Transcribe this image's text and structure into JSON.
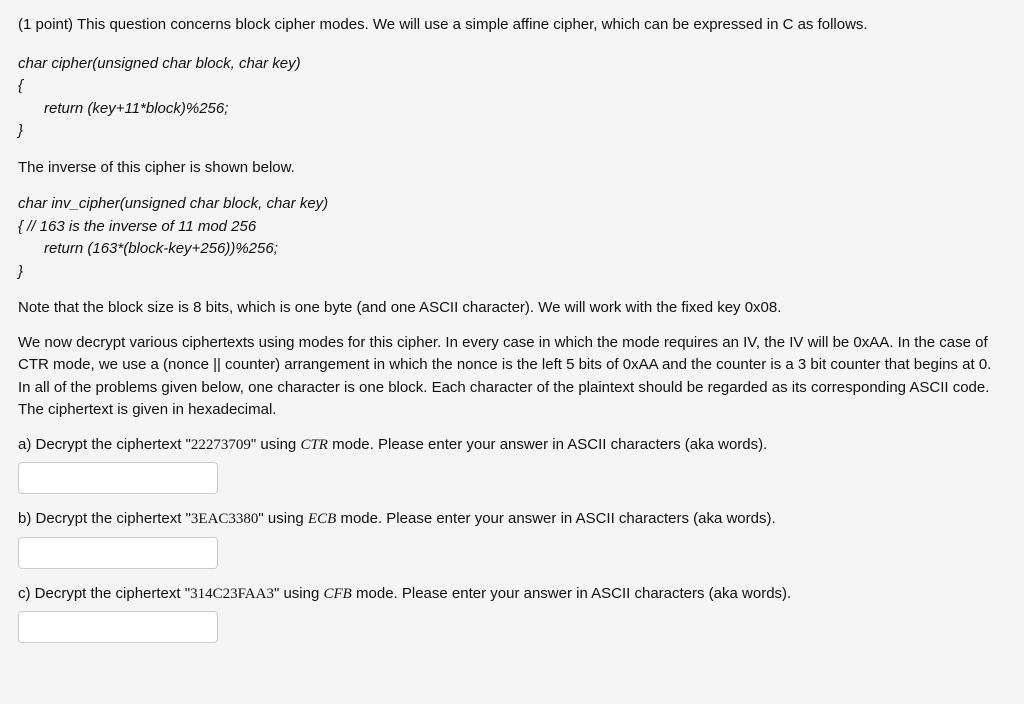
{
  "points": "(1 point)",
  "intro": "This question concerns block cipher modes. We will use a simple affine cipher, which can be expressed in C as follows.",
  "code1_l1": "char cipher(unsigned char block, char key)",
  "code1_l2": "{",
  "code1_l3": "return (key+11*block)%256;",
  "code1_l4": "}",
  "inverse_intro": "The inverse of this cipher is shown below.",
  "code2_l1": "char inv_cipher(unsigned char block, char key)",
  "code2_l2": "{ // 163 is the inverse of 11 mod 256",
  "code2_l3": "return (163*(block-key+256))%256;",
  "code2_l4": "}",
  "note": "Note that the block size is 8 bits, which is one byte (and one ASCII character). We will work with the fixed key 0x08.",
  "setup": "We now decrypt various ciphertexts using modes for this cipher. In every case in which the mode requires an IV, the IV will be 0xAA. In the case of CTR mode, we use a (nonce || counter) arrangement in which the nonce is the left 5 bits of 0xAA and the counter is a 3 bit counter that begins at 0. In all of the problems given below, one character is one block. Each character of the plaintext should be regarded as its corresponding ASCII code. The ciphertext is given in hexadecimal.",
  "a_prefix": "a) Decrypt the ciphertext \"",
  "a_ct": "22273709",
  "a_mid": "\" using ",
  "a_mode": "CTR",
  "a_suffix": " mode. Please enter your answer in ASCII characters (aka words).",
  "b_prefix": "b) Decrypt the ciphertext \"",
  "b_ct": "3EAC3380",
  "b_mid": "\" using ",
  "b_mode": "ECB",
  "b_suffix": " mode. Please enter your answer in ASCII characters (aka words).",
  "c_prefix": "c) Decrypt the ciphertext \"",
  "c_ct": "314C23FAA3",
  "c_mid": "\" using ",
  "c_mode": "CFB",
  "c_suffix": " mode. Please enter your answer in ASCII characters (aka words)."
}
